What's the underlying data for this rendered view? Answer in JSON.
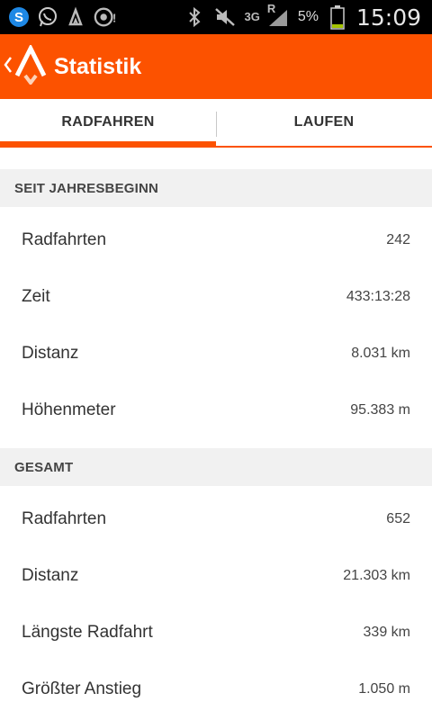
{
  "status_bar": {
    "time": "15:09",
    "battery_percent": "5%",
    "network_type": "3G",
    "roaming": "R",
    "icons": [
      "skype-icon",
      "whatsapp-icon",
      "strava-icon",
      "sync-alert-icon",
      "bluetooth-icon",
      "mute-icon",
      "signal-icon",
      "battery-icon"
    ]
  },
  "action_bar": {
    "title": "Statistik",
    "back_icon": "chevron-left-icon",
    "logo_icon": "strava-logo-icon",
    "color": "#fc5200"
  },
  "tabs": [
    {
      "label": "RADFAHREN",
      "active": true
    },
    {
      "label": "LAUFEN",
      "active": false
    }
  ],
  "sections": [
    {
      "header": "SEIT JAHRESBEGINN",
      "rows": [
        {
          "label": "Radfahrten",
          "value": "242"
        },
        {
          "label": "Zeit",
          "value": "433:13:28"
        },
        {
          "label": "Distanz",
          "value": "8.031 km"
        },
        {
          "label": "Höhenmeter",
          "value": "95.383 m"
        }
      ]
    },
    {
      "header": "GESAMT",
      "rows": [
        {
          "label": "Radfahrten",
          "value": "652"
        },
        {
          "label": "Distanz",
          "value": "21.303 km"
        },
        {
          "label": "Längste Radfahrt",
          "value": "339 km"
        },
        {
          "label": "Größter Anstieg",
          "value": "1.050 m"
        }
      ]
    }
  ]
}
